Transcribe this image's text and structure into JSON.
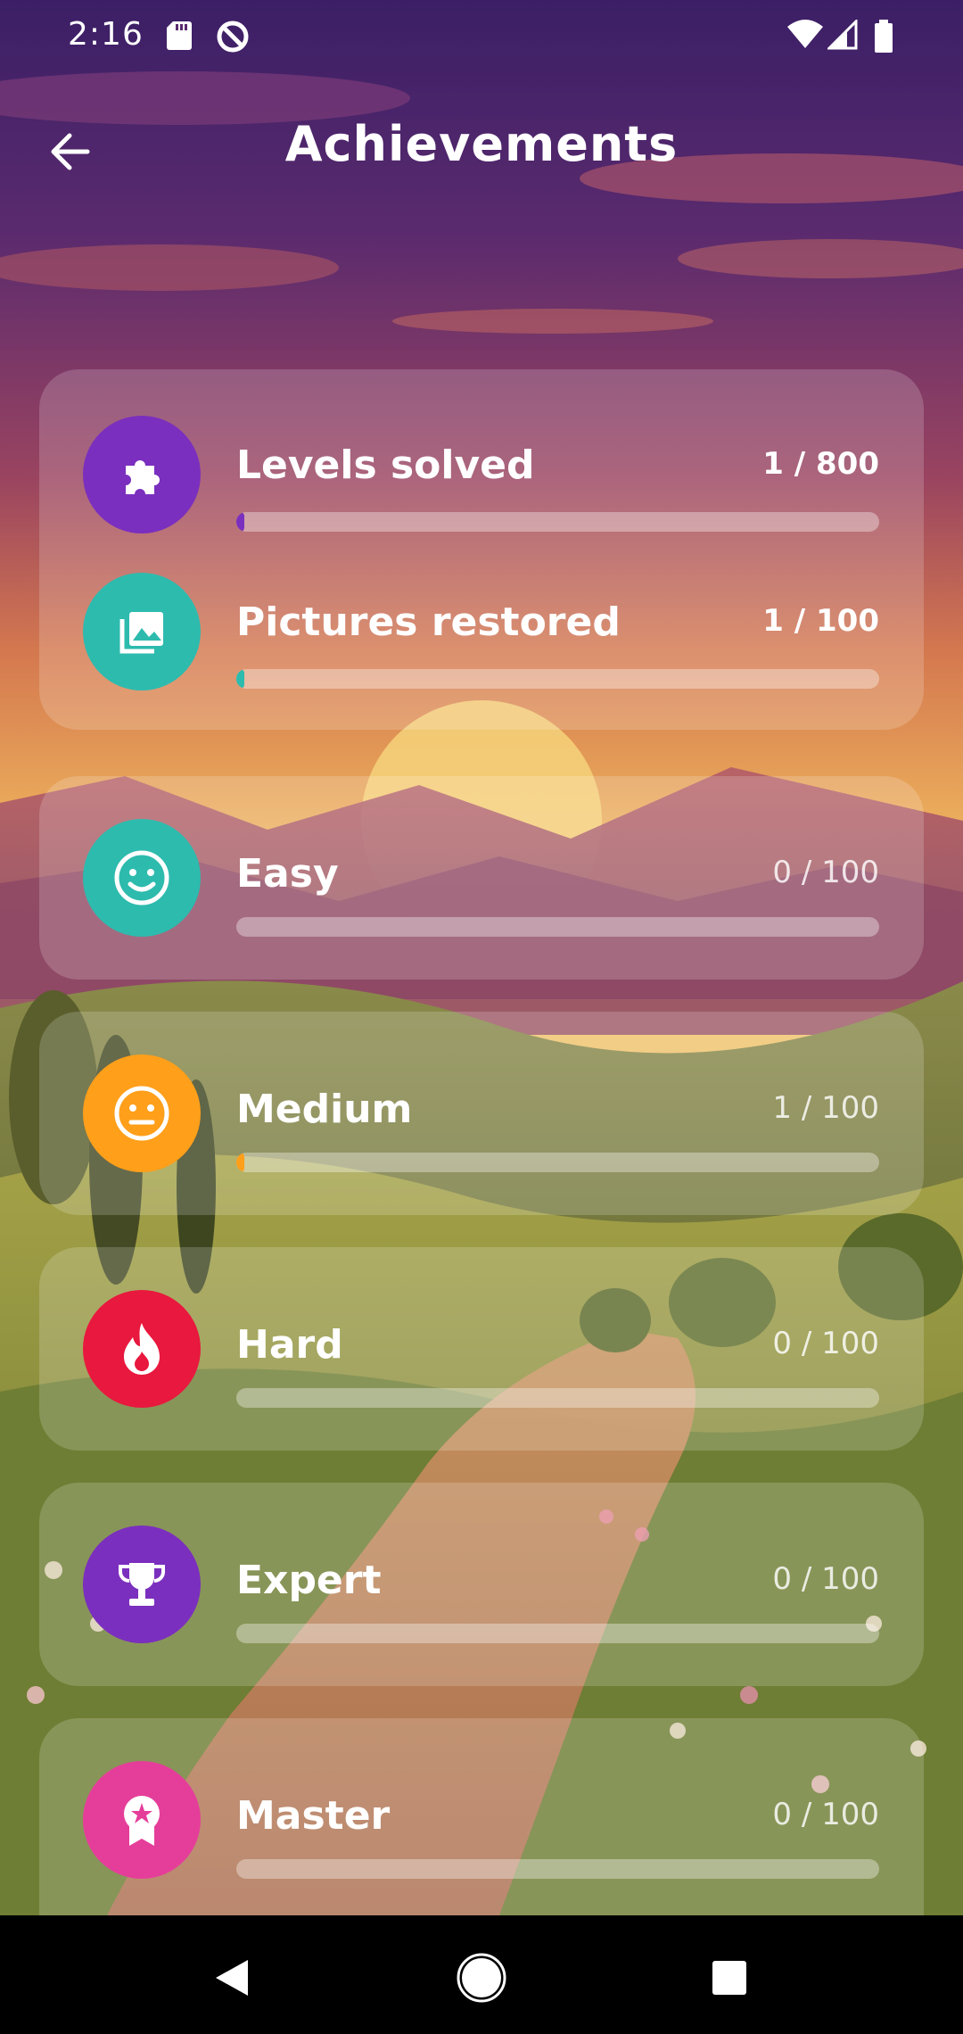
{
  "status_bar": {
    "time": "2:16",
    "left_icons": [
      "sd-card-icon",
      "data-saver-icon"
    ],
    "right_icons": [
      "wifi-icon",
      "signal-icon",
      "battery-icon"
    ]
  },
  "app_bar": {
    "title": "Achievements",
    "back_icon": "arrow-back-icon"
  },
  "summary": [
    {
      "label": "Levels solved",
      "count": "1 / 800",
      "progress": 0.00125,
      "icon": "puzzle-icon",
      "color": "#7B2FBE",
      "fill": "#7B2FBE"
    },
    {
      "label": "Pictures restored",
      "count": "1 / 100",
      "progress": 0.01,
      "icon": "image-library-icon",
      "color": "#2DBBAE",
      "fill": "#2DBBAE"
    }
  ],
  "difficulties": [
    {
      "label": "Easy",
      "count": "0 / 100",
      "progress": 0.0,
      "icon": "smile-icon",
      "color": "#2DBBAE"
    },
    {
      "label": "Medium",
      "count": "1 / 100",
      "progress": 0.01,
      "icon": "neutral-face-icon",
      "color": "#FF9F1A"
    },
    {
      "label": "Hard",
      "count": "0 / 100",
      "progress": 0.0,
      "icon": "flame-icon",
      "color": "#E8183E"
    },
    {
      "label": "Expert",
      "count": "0 / 100",
      "progress": 0.0,
      "icon": "trophy-icon",
      "color": "#7B2FBE"
    },
    {
      "label": "Master",
      "count": "0 / 100",
      "progress": 0.0,
      "icon": "medal-icon",
      "color": "#E53E9A"
    }
  ],
  "nav_bar": [
    "back-triangle-icon",
    "home-circle-icon",
    "recents-square-icon"
  ]
}
